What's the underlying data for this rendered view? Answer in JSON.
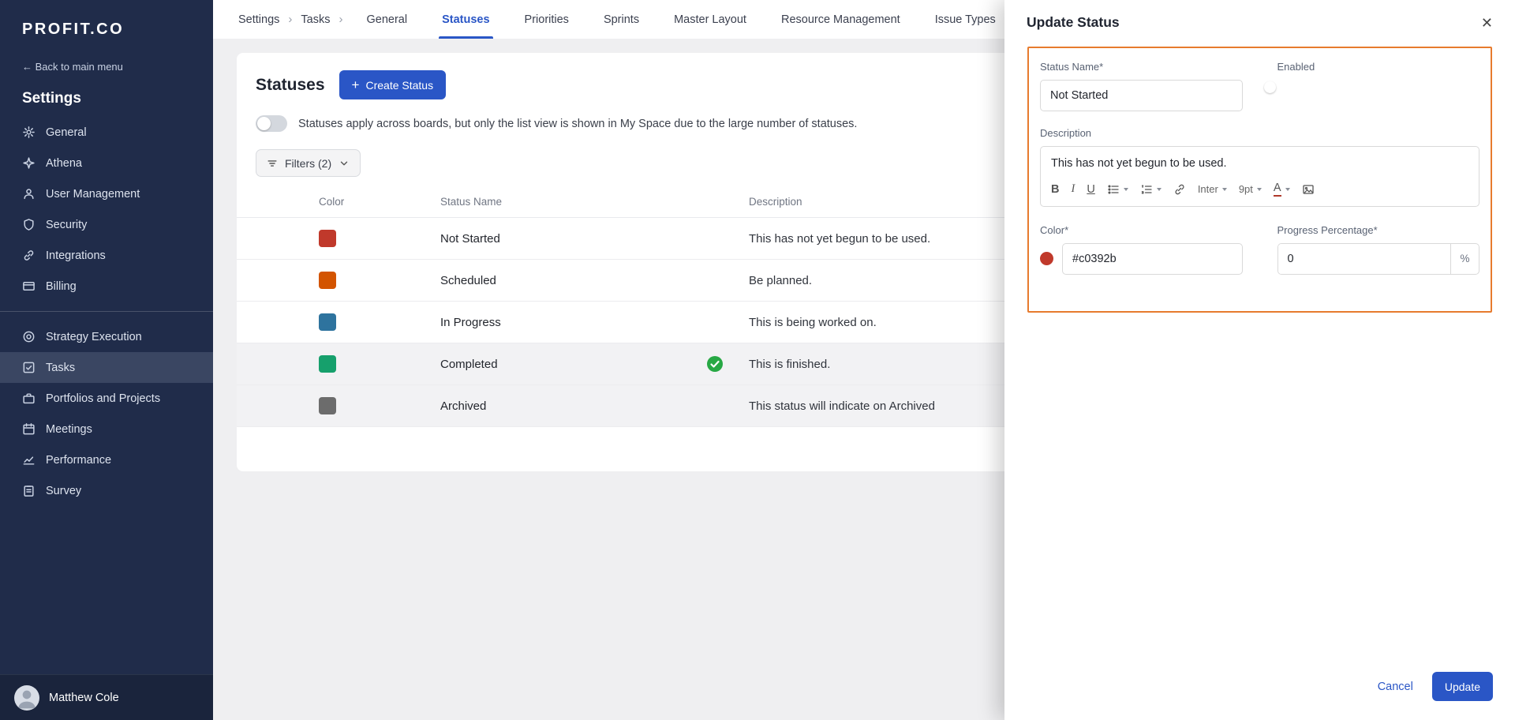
{
  "brand": {
    "logo": "PROFIT.CO"
  },
  "colors": {
    "accent": "#2a56c6",
    "form_highlight": "#e77b2e",
    "toggle_on": "#1f6bf2"
  },
  "sidebar": {
    "back_label": "← Back to main menu",
    "title": "Settings",
    "items": [
      {
        "label": "General"
      },
      {
        "label": "Athena"
      },
      {
        "label": "User Management"
      },
      {
        "label": "Security"
      },
      {
        "label": "Integrations"
      },
      {
        "label": "Billing"
      },
      {
        "label": "Strategy Execution"
      },
      {
        "label": "Tasks"
      },
      {
        "label": "Portfolios and Projects"
      },
      {
        "label": "Meetings"
      },
      {
        "label": "Performance"
      },
      {
        "label": "Survey"
      }
    ],
    "user_name": "Matthew Cole"
  },
  "topnav": {
    "breadcrumb": [
      "Settings",
      "Tasks"
    ],
    "separator": "›",
    "tabs": [
      "General",
      "Statuses",
      "Priorities",
      "Sprints",
      "Master Layout",
      "Resource Management",
      "Issue Types"
    ],
    "active_tab": "Statuses"
  },
  "content": {
    "title": "Statuses",
    "create_plus": "+",
    "create_button": "Create Status",
    "note": "Statuses apply across boards, but only the list view is shown in My Space due to the large number of statuses.",
    "filters_label": "Filters (2)",
    "table": {
      "headers": [
        "Color",
        "Status Name",
        "Description"
      ],
      "rows": [
        {
          "color": "#c0392b",
          "name": "Not Started",
          "description": "This has not yet begun to be used."
        },
        {
          "color": "#d35400",
          "name": "Scheduled",
          "description": "Be planned."
        },
        {
          "color": "#2e739e",
          "name": "In Progress",
          "description": "This is being worked on."
        },
        {
          "color": "#16a06c",
          "name": "Completed",
          "description": "This is finished."
        },
        {
          "color": "#6c6c6c",
          "name": "Archived",
          "description": "This status will indicate on Archived"
        }
      ]
    }
  },
  "drawer": {
    "title": "Update Status",
    "close_icon": "✕",
    "status_name_label": "Status Name*",
    "status_name_value": "Not Started",
    "enabled_label": "Enabled",
    "description_label": "Description",
    "description_value": "This has not yet begun to be used.",
    "toolbar": {
      "bold": "B",
      "italic": "I",
      "underline": "U",
      "font": "Inter",
      "size": "9pt",
      "color_letter": "A"
    },
    "color_label": "Color*",
    "color_value": "#c0392b",
    "progress_label": "Progress Percentage*",
    "progress_value": "0",
    "percent_suffix": "%",
    "cancel_label": "Cancel",
    "update_label": "Update"
  }
}
